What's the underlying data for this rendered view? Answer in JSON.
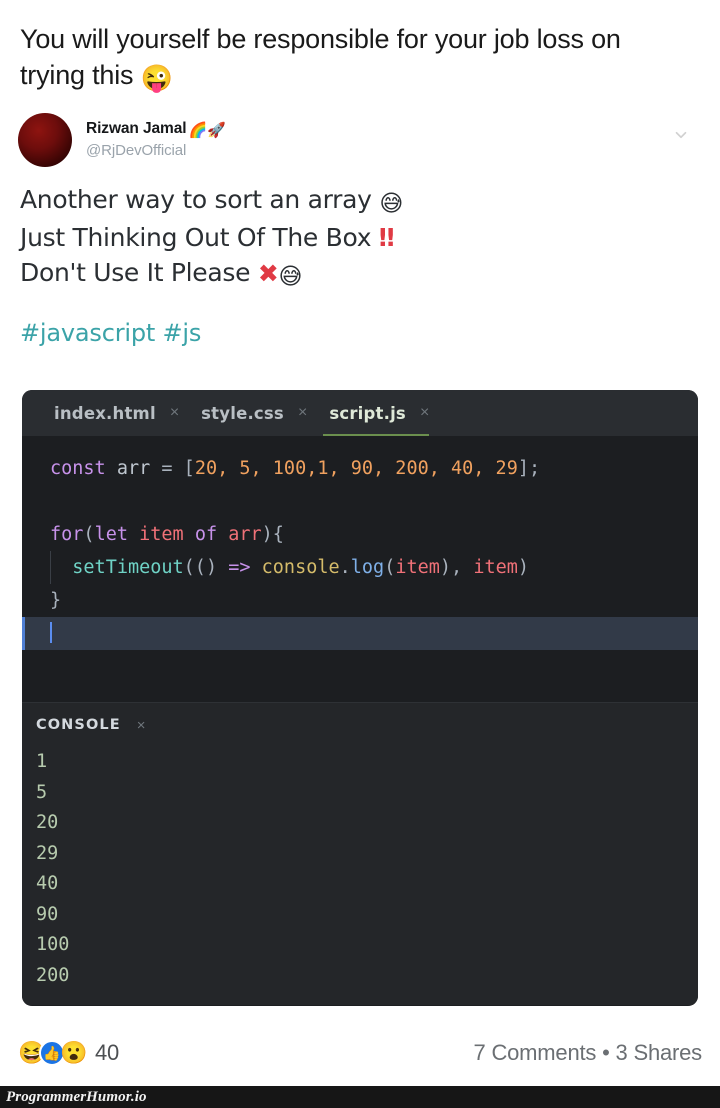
{
  "caption": {
    "line1": "You will yourself be responsible for your job loss on",
    "line2": "trying this",
    "emoji": "😜"
  },
  "tweet": {
    "author_name": "Rizwan Jamal",
    "author_emoji": "🌈🚀",
    "author_handle": "@RjDevOfficial",
    "more_icon": "chevron-down-icon",
    "body_line1": "Another way to sort an array",
    "body_line1_emoji": "😅",
    "body_line2": "Just Thinking Out Of The Box",
    "body_line2_marks": "‼",
    "body_line3": "Don't Use It Please",
    "body_line3_x": "✖",
    "body_line3_emoji": "😅",
    "hashtags": "#javascript #js"
  },
  "editor": {
    "tabs": [
      {
        "label": "index.html",
        "active": false,
        "close": "×"
      },
      {
        "label": "style.css",
        "active": false,
        "close": "×"
      },
      {
        "label": "script.js",
        "active": true,
        "close": "×"
      }
    ],
    "active_tab_accent": "#6b8f4e",
    "code": {
      "l1_kw": "const",
      "l1_var": " arr ",
      "l1_eq": "= [",
      "l1_nums": "20, 5, 100,1, 90, 200, 40, 29",
      "l1_end": "];",
      "l3_for": "for",
      "l3_p1": "(",
      "l3_let": "let",
      "l3_item": " item ",
      "l3_of": "of",
      "l3_arr": " arr",
      "l3_p2": "){",
      "l4_fn": "setTimeout",
      "l4_p1": "(() ",
      "l4_arrow": "=>",
      "l4_obj": " console",
      "l4_dot": ".",
      "l4_meth": "log",
      "l4_p2": "(",
      "l4_item1": "item",
      "l4_p3": "), ",
      "l4_item2": "item",
      "l4_p4": ")",
      "l5_brace": "}"
    }
  },
  "console": {
    "title": "CONSOLE",
    "close": "×",
    "output": [
      "1",
      "5",
      "20",
      "29",
      "40",
      "90",
      "100",
      "200"
    ]
  },
  "footer": {
    "reaction_haha": "😆",
    "reaction_like": "👍",
    "reaction_wow": "😮",
    "reaction_count": "40",
    "meta": "7 Comments • 3 Shares"
  },
  "watermark": {
    "text": "ProgrammerHumor.io"
  }
}
